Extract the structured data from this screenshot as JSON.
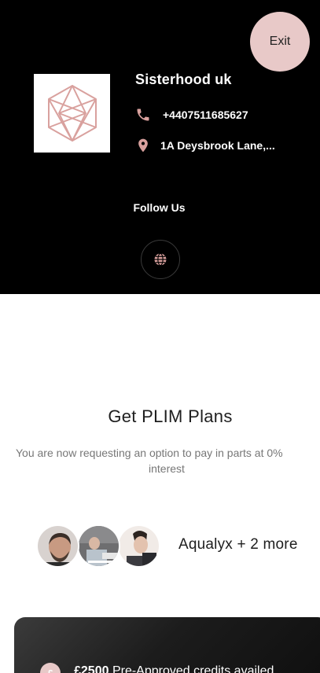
{
  "header": {
    "exit_label": "Exit",
    "business_name": "Sisterhood uk",
    "phone": "+4407511685627",
    "address": "1A Deysbrook Lane,...",
    "follow_label": "Follow Us",
    "logo_icon": "geometric-hexagon-logo",
    "accent_color": "#d9a19e",
    "background": "#000000"
  },
  "plans": {
    "title": "Get PLIM Plans",
    "subtitle_line1": "You are now requesting an option to pay in parts at 0%",
    "subtitle_line2": "interest"
  },
  "treatments": {
    "caption": "Aqualyx + 2 more",
    "avatars": [
      "man-portrait-avatar",
      "treatment-photo-avatar",
      "woman-portrait-avatar"
    ]
  },
  "credit": {
    "badge": "£",
    "amount": "£2500",
    "text": " Pre-Approved credits availed"
  }
}
